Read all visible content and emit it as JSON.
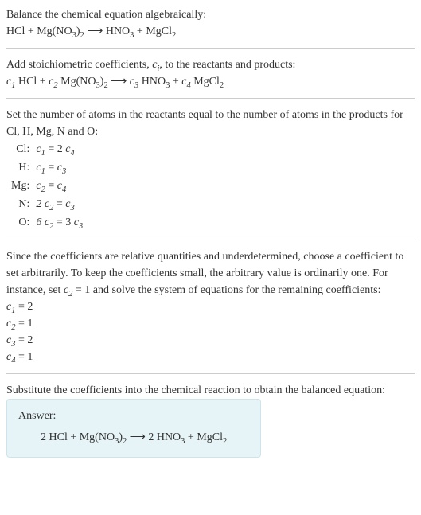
{
  "intro": {
    "line1": "Balance the chemical equation algebraically:",
    "eq_lhs1": "HCl + Mg(NO",
    "eq_lhs1_sub": "3",
    "eq_lhs2": ")",
    "eq_lhs2_sub": "2",
    "arrow": " ⟶ ",
    "eq_rhs1": "HNO",
    "eq_rhs1_sub": "3",
    "eq_rhs2": " + MgCl",
    "eq_rhs2_sub": "2"
  },
  "stoich": {
    "text_a": "Add stoichiometric coefficients, ",
    "ci_c": "c",
    "ci_i": "i",
    "text_b": ", to the reactants and products:",
    "c1": "c",
    "c1_sub": "1",
    "sp1": " HCl + ",
    "c2": "c",
    "c2_sub": "2",
    "sp2": " Mg(NO",
    "sp2_sub": "3",
    "sp2b": ")",
    "sp2b_sub": "2",
    "arrow": " ⟶ ",
    "c3": "c",
    "c3_sub": "3",
    "sp3": " HNO",
    "sp3_sub": "3",
    "sp3b": " + ",
    "c4": "c",
    "c4_sub": "4",
    "sp4": " MgCl",
    "sp4_sub": "2"
  },
  "atoms": {
    "text": "Set the number of atoms in the reactants equal to the number of atoms in the products for Cl, H, Mg, N and O:",
    "rows": [
      {
        "el": "Cl:",
        "lhs_c": "c",
        "lhs_sub": "1",
        "mid": " = 2 ",
        "rhs_c": "c",
        "rhs_sub": "4",
        "tail": ""
      },
      {
        "el": "H:",
        "lhs_c": "c",
        "lhs_sub": "1",
        "mid": " = ",
        "rhs_c": "c",
        "rhs_sub": "3",
        "tail": ""
      },
      {
        "el": "Mg:",
        "lhs_c": "c",
        "lhs_sub": "2",
        "mid": " = ",
        "rhs_c": "c",
        "rhs_sub": "4",
        "tail": ""
      },
      {
        "el": "N:",
        "lhs_c": "2 c",
        "lhs_sub": "2",
        "mid": " = ",
        "rhs_c": "c",
        "rhs_sub": "3",
        "tail": ""
      },
      {
        "el": "O:",
        "lhs_c": "6 c",
        "lhs_sub": "2",
        "mid": " = 3 ",
        "rhs_c": "c",
        "rhs_sub": "3",
        "tail": ""
      }
    ]
  },
  "choose": {
    "text_a": "Since the coefficients are relative quantities and underdetermined, choose a coefficient to set arbitrarily. To keep the coefficients small, the arbitrary value is ordinarily one. For instance, set ",
    "set_c": "c",
    "set_sub": "2",
    "set_eq": " = 1",
    "text_b": " and solve the system of equations for the remaining coefficients:",
    "results": [
      {
        "c": "c",
        "sub": "1",
        "val": " = 2"
      },
      {
        "c": "c",
        "sub": "2",
        "val": " = 1"
      },
      {
        "c": "c",
        "sub": "3",
        "val": " = 2"
      },
      {
        "c": "c",
        "sub": "4",
        "val": " = 1"
      }
    ]
  },
  "final": {
    "text": "Substitute the coefficients into the chemical reaction to obtain the balanced equation:",
    "answer_label": "Answer:",
    "eq_a": "2 HCl + Mg(NO",
    "eq_a_sub": "3",
    "eq_b": ")",
    "eq_b_sub": "2",
    "arrow": " ⟶ ",
    "eq_c": "2 HNO",
    "eq_c_sub": "3",
    "eq_d": " + MgCl",
    "eq_d_sub": "2"
  },
  "chart_data": {
    "type": "table",
    "title": "Balanced equation coefficients",
    "species": [
      "HCl",
      "Mg(NO3)2",
      "HNO3",
      "MgCl2"
    ],
    "coefficients": [
      2,
      1,
      2,
      1
    ],
    "atom_balance": {
      "Cl": "c1 = 2 c4",
      "H": "c1 = c3",
      "Mg": "c2 = c4",
      "N": "2 c2 = c3",
      "O": "6 c2 = 3 c3"
    }
  }
}
